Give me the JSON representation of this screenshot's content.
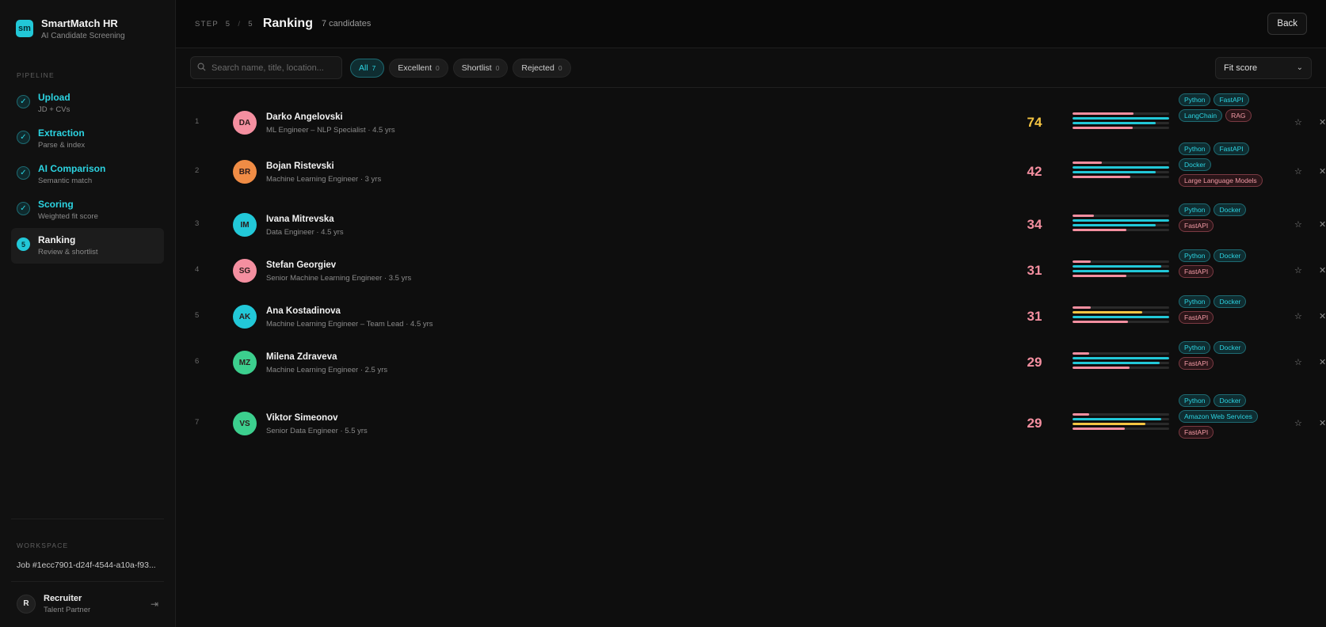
{
  "brand": {
    "logo": "sm",
    "name": "SmartMatch HR",
    "subtitle": "AI Candidate Screening"
  },
  "sidebar": {
    "pipeline_label": "PIPELINE",
    "items": [
      {
        "title": "Upload",
        "subtitle": "JD + CVs",
        "status": "done"
      },
      {
        "title": "Extraction",
        "subtitle": "Parse & index",
        "status": "done"
      },
      {
        "title": "AI Comparison",
        "subtitle": "Semantic match",
        "status": "done"
      },
      {
        "title": "Scoring",
        "subtitle": "Weighted fit score",
        "status": "done"
      },
      {
        "title": "Ranking",
        "subtitle": "Review & shortlist",
        "status": "active",
        "num": "5"
      }
    ],
    "workspace_label": "WORKSPACE",
    "job": "Job #1ecc7901-d24f-4544-a10a-f93...",
    "user": {
      "initial": "R",
      "name": "Recruiter",
      "role": "Talent Partner"
    }
  },
  "header": {
    "step_word": "STEP",
    "step_current": "5",
    "step_sep": "/",
    "step_total": "5",
    "title": "Ranking",
    "count": "7 candidates",
    "back": "Back"
  },
  "filters": {
    "search_placeholder": "Search name, title, location...",
    "chips": [
      {
        "label": "All",
        "count": "7",
        "active": true
      },
      {
        "label": "Excellent",
        "count": "0"
      },
      {
        "label": "Shortlist",
        "count": "0"
      },
      {
        "label": "Rejected",
        "count": "0"
      }
    ],
    "sort": "Fit score"
  },
  "colors": {
    "accent": "#22c8d8",
    "pink": "#f48fa0",
    "yellow": "#f5c542",
    "score_top": "#f5c542",
    "score_low": "#f48fa0"
  },
  "candidates": [
    {
      "rank": "1",
      "initials": "DA",
      "name": "Darko Angelovski",
      "subtitle": "ML Engineer – NLP Specialist · 4.5 yrs",
      "score": "74",
      "avatar_color": "#f48fa0",
      "score_color": "#f5c542",
      "bars": [
        {
          "v": 0.63,
          "c": "pink"
        },
        {
          "v": 1.0,
          "c": "accent"
        },
        {
          "v": 0.86,
          "c": "accent"
        },
        {
          "v": 0.62,
          "c": "pink"
        }
      ],
      "tags": [
        {
          "t": "Python",
          "k": "match"
        },
        {
          "t": "FastAPI",
          "k": "match"
        },
        {
          "t": "LangChain",
          "k": "match"
        },
        {
          "t": "RAG",
          "k": "miss"
        }
      ]
    },
    {
      "rank": "2",
      "initials": "BR",
      "name": "Bojan Ristevski",
      "subtitle": "Machine Learning Engineer · 3 yrs",
      "score": "42",
      "avatar_color": "#f08c45",
      "score_color": "#f48fa0",
      "bars": [
        {
          "v": 0.3,
          "c": "pink"
        },
        {
          "v": 1.0,
          "c": "accent"
        },
        {
          "v": 0.86,
          "c": "accent"
        },
        {
          "v": 0.6,
          "c": "pink"
        }
      ],
      "tags": [
        {
          "t": "Python",
          "k": "match"
        },
        {
          "t": "FastAPI",
          "k": "match"
        },
        {
          "t": "Docker",
          "k": "match"
        },
        {
          "t": "Large Language Models",
          "k": "miss"
        }
      ]
    },
    {
      "rank": "3",
      "initials": "IM",
      "name": "Ivana Mitrevska",
      "subtitle": "Data Engineer · 4.5 yrs",
      "score": "34",
      "avatar_color": "#22c8d8",
      "score_color": "#f48fa0",
      "bars": [
        {
          "v": 0.22,
          "c": "pink"
        },
        {
          "v": 1.0,
          "c": "accent"
        },
        {
          "v": 0.86,
          "c": "accent"
        },
        {
          "v": 0.56,
          "c": "pink"
        }
      ],
      "tags": [
        {
          "t": "Python",
          "k": "match"
        },
        {
          "t": "Docker",
          "k": "match"
        },
        {
          "t": "FastAPI",
          "k": "miss"
        }
      ]
    },
    {
      "rank": "4",
      "initials": "SG",
      "name": "Stefan Georgiev",
      "subtitle": "Senior Machine Learning Engineer · 3.5 yrs",
      "score": "31",
      "avatar_color": "#f48fa0",
      "score_color": "#f48fa0",
      "bars": [
        {
          "v": 0.19,
          "c": "pink"
        },
        {
          "v": 0.92,
          "c": "accent"
        },
        {
          "v": 1.0,
          "c": "accent"
        },
        {
          "v": 0.56,
          "c": "pink"
        }
      ],
      "tags": [
        {
          "t": "Python",
          "k": "match"
        },
        {
          "t": "Docker",
          "k": "match"
        },
        {
          "t": "FastAPI",
          "k": "miss"
        }
      ]
    },
    {
      "rank": "5",
      "initials": "AK",
      "name": "Ana Kostadinova",
      "subtitle": "Machine Learning Engineer – Team Lead · 4.5 yrs",
      "score": "31",
      "avatar_color": "#22c8d8",
      "score_color": "#f48fa0",
      "bars": [
        {
          "v": 0.19,
          "c": "pink"
        },
        {
          "v": 0.72,
          "c": "yellow"
        },
        {
          "v": 1.0,
          "c": "accent"
        },
        {
          "v": 0.57,
          "c": "pink"
        }
      ],
      "tags": [
        {
          "t": "Python",
          "k": "match"
        },
        {
          "t": "Docker",
          "k": "match"
        },
        {
          "t": "FastAPI",
          "k": "miss"
        }
      ]
    },
    {
      "rank": "6",
      "initials": "MZ",
      "name": "Milena Zdraveva",
      "subtitle": "Machine Learning Engineer · 2.5 yrs",
      "score": "29",
      "avatar_color": "#3ccf8e",
      "score_color": "#f48fa0",
      "bars": [
        {
          "v": 0.17,
          "c": "pink"
        },
        {
          "v": 1.0,
          "c": "accent"
        },
        {
          "v": 0.9,
          "c": "accent"
        },
        {
          "v": 0.59,
          "c": "pink"
        }
      ],
      "tags": [
        {
          "t": "Python",
          "k": "match"
        },
        {
          "t": "Docker",
          "k": "match"
        },
        {
          "t": "FastAPI",
          "k": "miss"
        }
      ]
    },
    {
      "rank": "7",
      "initials": "VS",
      "name": "Viktor Simeonov",
      "subtitle": "Senior Data Engineer · 5.5 yrs",
      "score": "29",
      "avatar_color": "#3ccf8e",
      "score_color": "#f48fa0",
      "bars": [
        {
          "v": 0.17,
          "c": "pink"
        },
        {
          "v": 0.92,
          "c": "accent"
        },
        {
          "v": 0.75,
          "c": "yellow"
        },
        {
          "v": 0.54,
          "c": "pink"
        }
      ],
      "tags": [
        {
          "t": "Python",
          "k": "match"
        },
        {
          "t": "Docker",
          "k": "match"
        },
        {
          "t": "Amazon Web Services",
          "k": "match"
        },
        {
          "t": "FastAPI",
          "k": "miss"
        }
      ]
    }
  ],
  "icons": {
    "check": "check-icon",
    "search": "search-icon",
    "star": "star-icon",
    "close": "close-icon",
    "logout": "logout-icon",
    "chevron": "chevron-down-icon"
  }
}
